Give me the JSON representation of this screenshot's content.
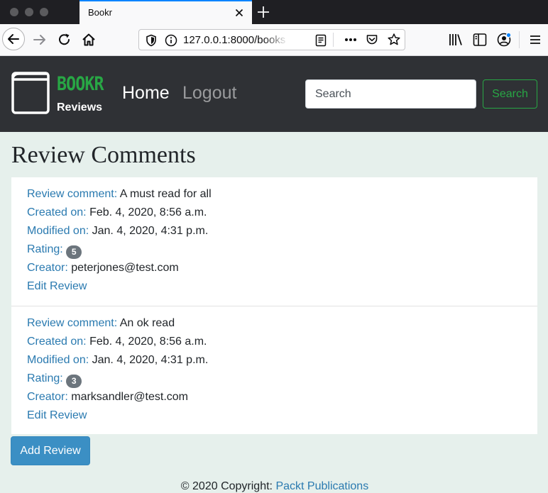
{
  "browser": {
    "tab_title": "Bookr",
    "url": "127.0.0.1:8000/books",
    "icons": [
      "back-icon",
      "forward-icon",
      "reload-icon",
      "home-icon",
      "shield-icon",
      "info-icon",
      "reader-view-icon",
      "more-icon",
      "pocket-icon",
      "bookmark-star-icon",
      "library-icon",
      "sidebar-icon",
      "account-icon",
      "menu-icon"
    ]
  },
  "header": {
    "brand_name": "BOOKR",
    "brand_sub": "Reviews",
    "nav": {
      "home": "Home",
      "logout": "Logout"
    },
    "search": {
      "placeholder": "Search",
      "button_label": "Search"
    }
  },
  "page": {
    "title": "Review Comments"
  },
  "labels": {
    "comment": "Review comment:",
    "created": "Created on:",
    "modified": "Modified on:",
    "rating": "Rating:",
    "creator": "Creator:",
    "edit": "Edit Review"
  },
  "reviews": [
    {
      "comment": "A must read for all",
      "created": "Feb. 4, 2020, 8:56 a.m.",
      "modified": "Jan. 4, 2020, 4:31 p.m.",
      "rating": "5",
      "creator": "peterjones@test.com"
    },
    {
      "comment": "An ok read",
      "created": "Feb. 4, 2020, 8:56 a.m.",
      "modified": "Jan. 4, 2020, 4:31 p.m.",
      "rating": "3",
      "creator": "marksandler@test.com"
    }
  ],
  "actions": {
    "add_review": "Add Review"
  },
  "footer": {
    "text": "© 2020 Copyright:",
    "link": "Packt Publications"
  },
  "colors": {
    "brand_green": "#28a745",
    "link_blue": "#2a7ab0",
    "header_bg": "#2f3135",
    "page_bg": "#e6f0ec",
    "button_blue": "#3b8fc4"
  }
}
